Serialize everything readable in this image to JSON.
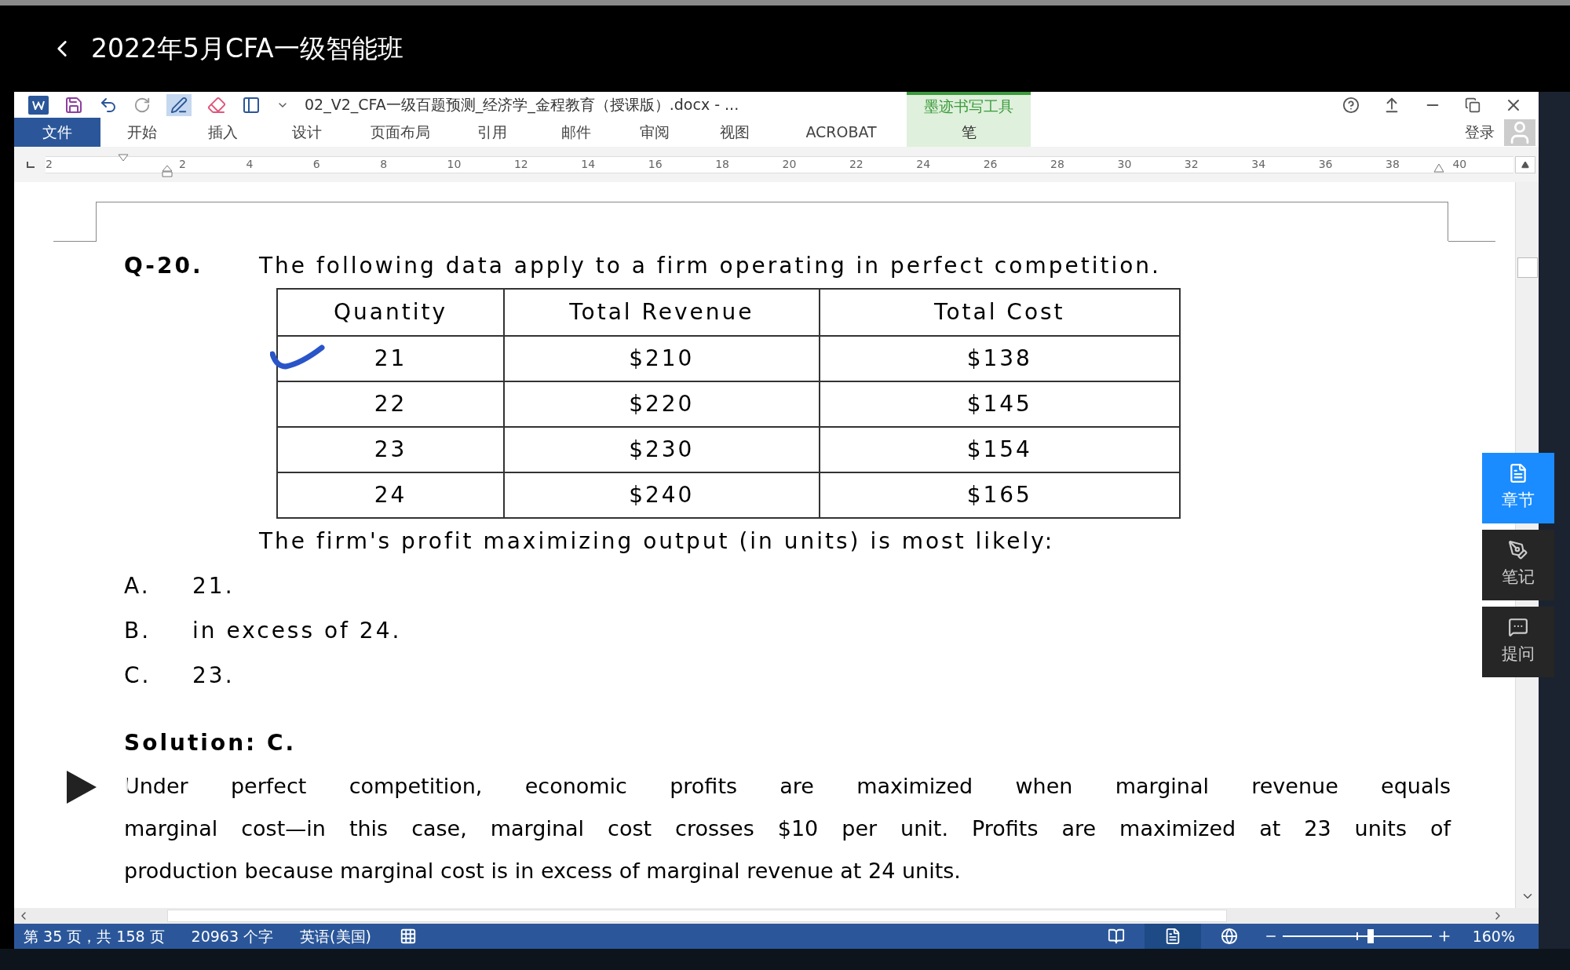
{
  "header": {
    "title": "2022年5月CFA一级智能班"
  },
  "word": {
    "title_bar": {
      "document_title": "02_V2_CFA一级百题预测_经济学_金程教育（授课版）.docx - ...",
      "contextual_group": "墨迹书写工具"
    },
    "tabs": [
      {
        "label": "文件",
        "kind": "file"
      },
      {
        "label": "开始",
        "kind": "normal"
      },
      {
        "label": "插入",
        "kind": "normal"
      },
      {
        "label": "设计",
        "kind": "normal"
      },
      {
        "label": "页面布局",
        "kind": "normal"
      },
      {
        "label": "引用",
        "kind": "normal"
      },
      {
        "label": "邮件",
        "kind": "normal"
      },
      {
        "label": "审阅",
        "kind": "normal"
      },
      {
        "label": "视图",
        "kind": "normal"
      },
      {
        "label": "ACROBAT",
        "kind": "normal"
      },
      {
        "label": "笔",
        "kind": "contextual"
      }
    ],
    "sign_in": "登录",
    "ruler": [
      "2",
      "2",
      "4",
      "6",
      "8",
      "10",
      "12",
      "14",
      "16",
      "18",
      "20",
      "22",
      "24",
      "26",
      "28",
      "30",
      "32",
      "34",
      "36",
      "38",
      "40"
    ],
    "document": {
      "question": {
        "number": "Q-20.",
        "text": "The following data apply to a firm operating in perfect competition."
      },
      "table": {
        "columns": [
          "Quantity",
          "Total Revenue",
          "Total Cost"
        ],
        "rows": [
          {
            "cells": [
              "21",
              "$210",
              "$138"
            ],
            "marked": true
          },
          {
            "cells": [
              "22",
              "$220",
              "$145"
            ],
            "marked": false
          },
          {
            "cells": [
              "23",
              "$230",
              "$154"
            ],
            "marked": false
          },
          {
            "cells": [
              "24",
              "$240",
              "$165"
            ],
            "marked": false
          }
        ]
      },
      "prompt": "The firm's profit maximizing output (in units) is most likely:",
      "options": [
        {
          "letter": "A.",
          "text": "21."
        },
        {
          "letter": "B.",
          "text": "in excess of 24."
        },
        {
          "letter": "C.",
          "text": "23."
        }
      ],
      "solution": {
        "heading": "Solution: C.",
        "lines": [
          "Under perfect competition, economic profits are maximized when marginal revenue equals",
          "marginal cost—in this case, marginal cost crosses $10 per unit. Profits are maximized at 23 units of",
          "production because marginal cost is in excess of marginal revenue at 24 units."
        ]
      }
    },
    "status_bar": {
      "page": "第 35 页，共 158 页",
      "words": "20963 个字",
      "language": "英语(美国)",
      "views": [
        {
          "kind": "read",
          "selected": false
        },
        {
          "kind": "print",
          "selected": true
        },
        {
          "kind": "web",
          "selected": false
        }
      ],
      "zoom": {
        "level": 0.59,
        "reading": "160%"
      }
    }
  },
  "side_panel": [
    {
      "label": "章节",
      "kind": "chapters",
      "selected": true
    },
    {
      "label": "笔记",
      "kind": "notes",
      "selected": false
    },
    {
      "label": "提问",
      "kind": "questions",
      "selected": false
    }
  ]
}
